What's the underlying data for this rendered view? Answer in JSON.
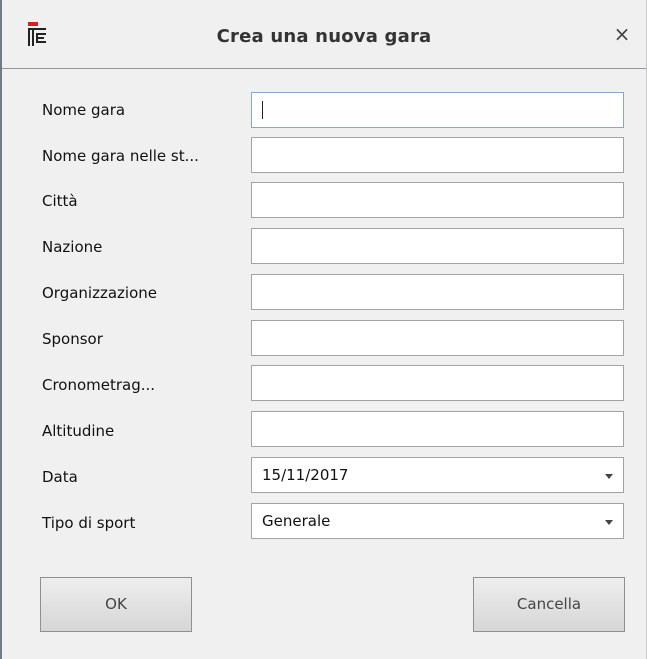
{
  "window": {
    "title": "Crea una nuova gara",
    "app_icon": "app-logo-icon",
    "close_label": "×"
  },
  "fields": [
    {
      "label": "Nome gara",
      "value": "",
      "placeholder": ""
    },
    {
      "label": "Nome gara nelle st...",
      "value": "",
      "placeholder": ""
    },
    {
      "label": "Città",
      "value": "",
      "placeholder": ""
    },
    {
      "label": "Nazione",
      "value": "",
      "placeholder": ""
    },
    {
      "label": "Organizzazione",
      "value": "",
      "placeholder": ""
    },
    {
      "label": "Sponsor",
      "value": "",
      "placeholder": ""
    },
    {
      "label": "Cronometrag...",
      "value": "",
      "placeholder": ""
    },
    {
      "label": "Altitudine",
      "value": "",
      "placeholder": ""
    }
  ],
  "date": {
    "label": "Data",
    "value": "15/11/2017"
  },
  "sport": {
    "label": "Tipo di sport",
    "value": "Generale"
  },
  "buttons": {
    "ok": "OK",
    "cancel": "Cancella"
  },
  "colors": {
    "accent_red": "#d42020",
    "focus_border": "#86a8d0"
  }
}
